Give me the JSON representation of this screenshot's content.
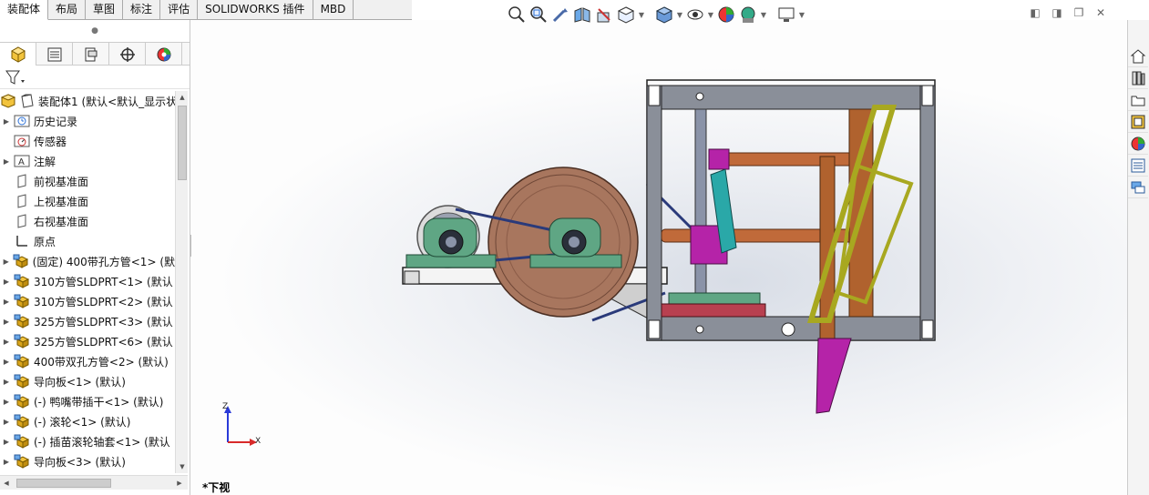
{
  "tabs": [
    {
      "label": "装配体",
      "active": true
    },
    {
      "label": "布局",
      "active": false
    },
    {
      "label": "草图",
      "active": false
    },
    {
      "label": "标注",
      "active": false
    },
    {
      "label": "评估",
      "active": false
    },
    {
      "label": "SOLIDWORKS 插件",
      "active": false
    },
    {
      "label": "MBD",
      "active": false
    }
  ],
  "heads_up_toolbar": {
    "icons": [
      "zoom-to-fit-icon",
      "zoom-to-area-icon",
      "previous-view-icon",
      "section-view-icon",
      "dynamic-annotation-icon",
      "view-orientation-icon",
      "display-style-icon",
      "hide-show-items-icon",
      "edit-appearance-icon",
      "apply-scene-icon",
      "view-settings-icon"
    ]
  },
  "feature_tree": {
    "root": "装配体1  (默认<默认_显示状",
    "items": [
      {
        "label": "历史记录",
        "icon": "history-folder-icon",
        "expandable": true
      },
      {
        "label": "传感器",
        "icon": "sensor-icon",
        "expandable": false
      },
      {
        "label": "注解",
        "icon": "annotation-icon",
        "expandable": true
      },
      {
        "label": "前视基准面",
        "icon": "plane-icon",
        "expandable": false
      },
      {
        "label": "上视基准面",
        "icon": "plane-icon",
        "expandable": false
      },
      {
        "label": "右视基准面",
        "icon": "plane-icon",
        "expandable": false
      },
      {
        "label": "原点",
        "icon": "origin-icon",
        "expandable": false
      },
      {
        "label": "(固定) 400带孔方管<1> (默",
        "icon": "part-icon",
        "expandable": true
      },
      {
        "label": "310方管SLDPRT<1> (默认",
        "icon": "part-icon",
        "expandable": true
      },
      {
        "label": "310方管SLDPRT<2> (默认",
        "icon": "part-icon",
        "expandable": true
      },
      {
        "label": "325方管SLDPRT<3> (默认",
        "icon": "part-icon",
        "expandable": true
      },
      {
        "label": "325方管SLDPRT<6> (默认",
        "icon": "part-icon",
        "expandable": true
      },
      {
        "label": "400带双孔方管<2> (默认)",
        "icon": "part-icon",
        "expandable": true
      },
      {
        "label": "导向板<1> (默认)",
        "icon": "part-icon",
        "expandable": true
      },
      {
        "label": "(-) 鸭嘴带插干<1> (默认)",
        "icon": "part-icon",
        "expandable": true
      },
      {
        "label": "(-) 滚轮<1> (默认)",
        "icon": "part-icon",
        "expandable": true
      },
      {
        "label": "(-) 插苗滚轮轴套<1> (默认",
        "icon": "part-icon",
        "expandable": true
      },
      {
        "label": "导向板<3> (默认)",
        "icon": "part-icon",
        "expandable": true
      }
    ]
  },
  "viewport": {
    "view_name": "*下视",
    "triad": {
      "z_label": "Z",
      "x_label": "X"
    }
  },
  "colors": {
    "frame_gray": "#8a8f99",
    "rod_copper": "#c06a3a",
    "bearing_green": "#5fa684",
    "pulley_brown": "#a8765e",
    "link_magenta": "#b523a8",
    "link_olive": "#a8a820",
    "link_teal": "#2aa8a8"
  }
}
